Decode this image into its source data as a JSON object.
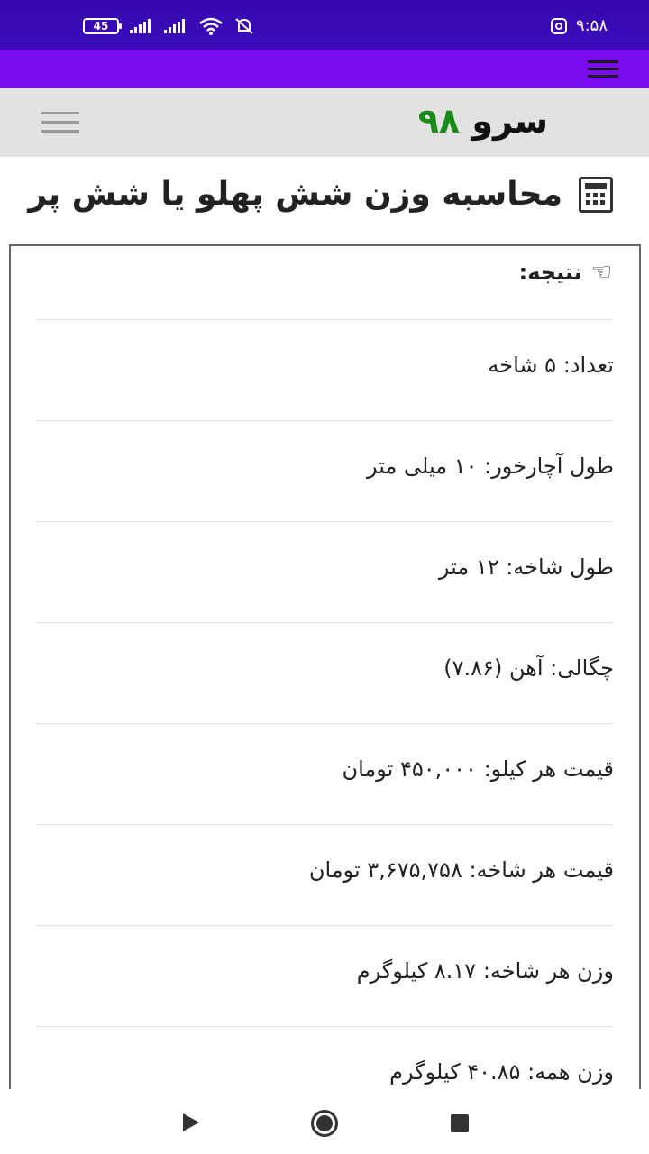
{
  "status_bar": {
    "battery": "45",
    "time": "۹:۵۸"
  },
  "header": {
    "logo_text": "سرو",
    "logo_number": "۹۸"
  },
  "page": {
    "title": "محاسبه وزن شش پهلو یا شش پر"
  },
  "result": {
    "heading": "نتیجه:",
    "rows": [
      "تعداد: ۵ شاخه",
      "طول آچارخور: ۱۰ میلی متر",
      "طول شاخه: ۱۲ متر",
      "چگالی: آهن (۷.۸۶)",
      "قیمت هر کیلو: ۴۵۰,۰۰۰ تومان",
      "قیمت هر شاخه: ۳,۶۷۵,۷۵۸ تومان",
      "وزن هر شاخه: ۸.۱۷ کیلوگرم",
      "وزن همه: ۴۰.۸۵ کیلوگرم"
    ]
  },
  "colors": {
    "status_bar": "#3508b0",
    "app_bar": "#7a0df0",
    "header_bg": "#e2e2e2",
    "logo_number": "#1a8a1a"
  }
}
